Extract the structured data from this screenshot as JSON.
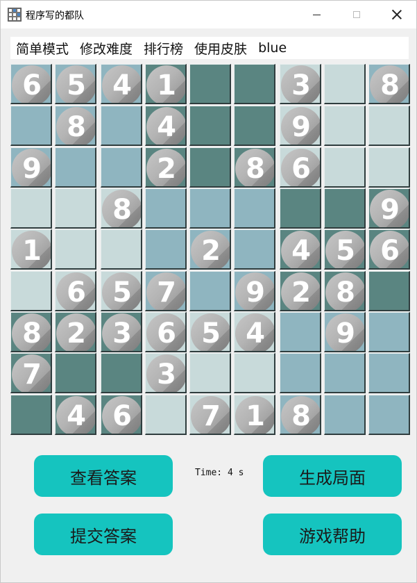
{
  "window": {
    "title": "程序写的都队",
    "close_glyph": "×"
  },
  "menu": [
    "简单模式",
    "修改难度",
    "排行榜",
    "使用皮肤",
    "blue"
  ],
  "board": {
    "rows": [
      [
        6,
        5,
        4,
        1,
        null,
        null,
        3,
        null,
        8
      ],
      [
        null,
        8,
        null,
        4,
        null,
        null,
        9,
        null,
        null
      ],
      [
        9,
        null,
        null,
        2,
        null,
        8,
        6,
        null,
        null
      ],
      [
        null,
        null,
        8,
        null,
        null,
        null,
        null,
        null,
        9
      ],
      [
        1,
        null,
        null,
        null,
        2,
        null,
        4,
        5,
        6
      ],
      [
        null,
        6,
        5,
        7,
        null,
        9,
        2,
        8,
        null
      ],
      [
        8,
        2,
        3,
        6,
        5,
        4,
        null,
        9,
        null
      ],
      [
        7,
        null,
        null,
        3,
        null,
        null,
        null,
        null,
        null
      ],
      [
        null,
        4,
        6,
        null,
        7,
        1,
        8,
        null,
        null
      ]
    ],
    "shades": [
      [
        "mid",
        "mid",
        "mid",
        "dark",
        "dark",
        "dark",
        "light",
        "light",
        "mid"
      ],
      [
        "mid",
        "mid",
        "mid",
        "dark",
        "dark",
        "dark",
        "light",
        "light",
        "light"
      ],
      [
        "mid",
        "mid",
        "mid",
        "dark",
        "dark",
        "dark",
        "light",
        "light",
        "light"
      ],
      [
        "light",
        "light",
        "light",
        "mid",
        "mid",
        "mid",
        "dark",
        "dark",
        "dark"
      ],
      [
        "light",
        "light",
        "light",
        "mid",
        "mid",
        "mid",
        "dark",
        "dark",
        "dark"
      ],
      [
        "light",
        "light",
        "light",
        "mid",
        "mid",
        "mid",
        "dark",
        "dark",
        "dark"
      ],
      [
        "dark",
        "dark",
        "dark",
        "light",
        "light",
        "light",
        "mid",
        "mid",
        "mid"
      ],
      [
        "dark",
        "dark",
        "dark",
        "light",
        "light",
        "light",
        "mid",
        "mid",
        "mid"
      ],
      [
        "dark",
        "dark",
        "dark",
        "light",
        "light",
        "light",
        "mid",
        "mid",
        "mid"
      ]
    ]
  },
  "timer_text": "Time: 4 s",
  "buttons": {
    "check_answer": "查看答案",
    "generate": "生成局面",
    "submit": "提交答案",
    "help": "游戏帮助"
  },
  "colors": {
    "accent_button": "#15c4bf",
    "cell_dark": "#5a8581",
    "cell_mid": "#8fb5c0",
    "cell_light": "#c8dada"
  }
}
